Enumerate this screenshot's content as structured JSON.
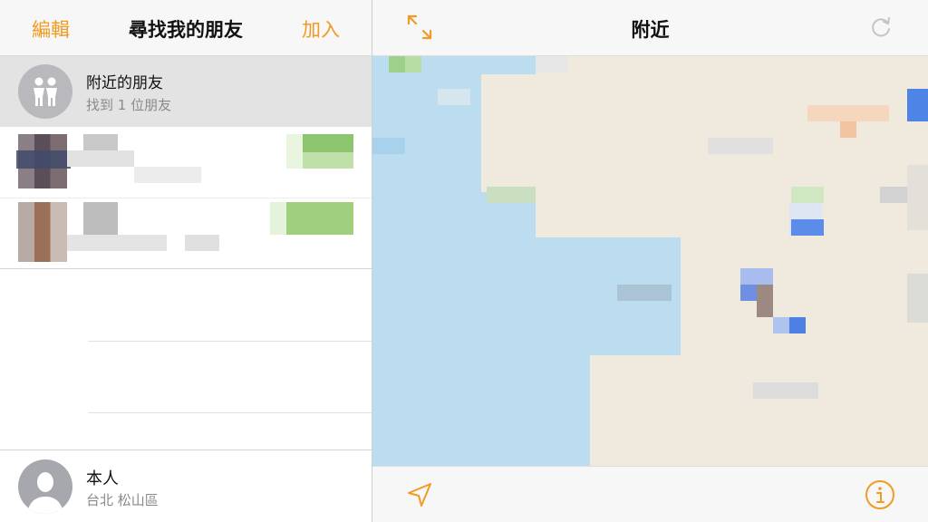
{
  "left_header": {
    "edit_label": "編輯",
    "title": "尋找我的朋友",
    "add_label": "加入"
  },
  "nearby": {
    "title": "附近的朋友",
    "subtitle": "找到 1 位朋友"
  },
  "self": {
    "name": "本人",
    "location": "台北 松山區"
  },
  "right_header": {
    "title": "附近"
  },
  "colors": {
    "accent": "#f29a22",
    "header_bg": "#f7f7f7",
    "selected_row_bg": "#e3e3e3",
    "map_water": "#bcdcf0",
    "map_land": "#efe9de"
  },
  "icons": {
    "expand": "expand-arrows-icon",
    "refresh": "refresh-icon",
    "locate": "location-arrow-icon",
    "info": "info-icon",
    "nearby_friends": "people-icon",
    "self_avatar": "person-silhouette-icon"
  }
}
